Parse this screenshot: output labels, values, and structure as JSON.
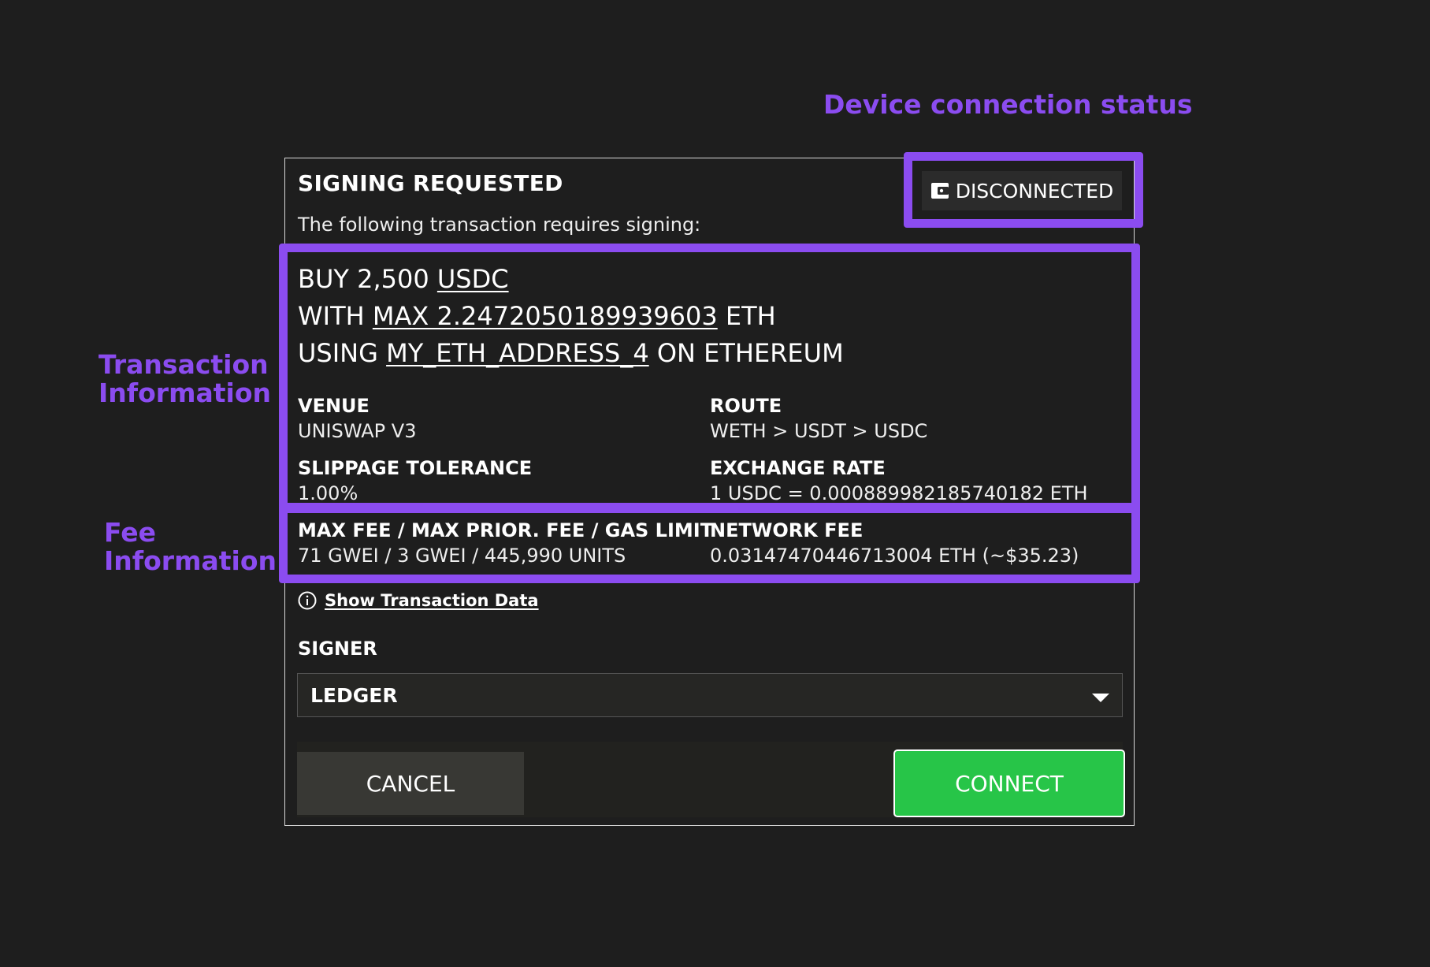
{
  "annotations": {
    "device_status": "Device connection status",
    "transaction_line1": "Transaction",
    "transaction_line2": "Information",
    "fee_line1": "Fee",
    "fee_line2": "Information"
  },
  "dialog": {
    "title": "SIGNING REQUESTED",
    "subtitle": "The following transaction requires signing:",
    "status": {
      "label": "DISCONNECTED",
      "icon": "wallet-icon"
    }
  },
  "transaction": {
    "line1_prefix": "BUY 2,500 ",
    "line1_token": "USDC",
    "line2_prefix": "WITH ",
    "line2_amount": "MAX 2.2472050189939603",
    "line2_suffix": " ETH",
    "line3_prefix": "USING ",
    "line3_address": "MY_ETH_ADDRESS_4",
    "line3_suffix": " ON ETHEREUM"
  },
  "details": {
    "venue": {
      "label": "VENUE",
      "value": "UNISWAP V3"
    },
    "route": {
      "label": "ROUTE",
      "value": "WETH > USDT > USDC"
    },
    "slippage": {
      "label": "SLIPPAGE TOLERANCE",
      "value": "1.00%"
    },
    "exchange_rate": {
      "label": "EXCHANGE RATE",
      "value": "1 USDC = 0.000889982185740182 ETH"
    },
    "gas": {
      "label": "MAX FEE / MAX PRIOR. FEE / GAS LIMIT",
      "value": "71 GWEI / 3 GWEI / 445,990 UNITS"
    },
    "network_fee": {
      "label": "NETWORK FEE",
      "value": "0.03147470446713004 ETH (~$35.23)"
    }
  },
  "show_data": {
    "label": "Show Transaction Data",
    "icon": "info-icon"
  },
  "signer": {
    "label": "SIGNER",
    "selected": "LEDGER"
  },
  "footer": {
    "cancel_label": "CANCEL",
    "connect_label": "CONNECT"
  },
  "colors": {
    "background": "#1e1e1e",
    "annotation": "#8b4cf0",
    "connect": "#27c548"
  }
}
